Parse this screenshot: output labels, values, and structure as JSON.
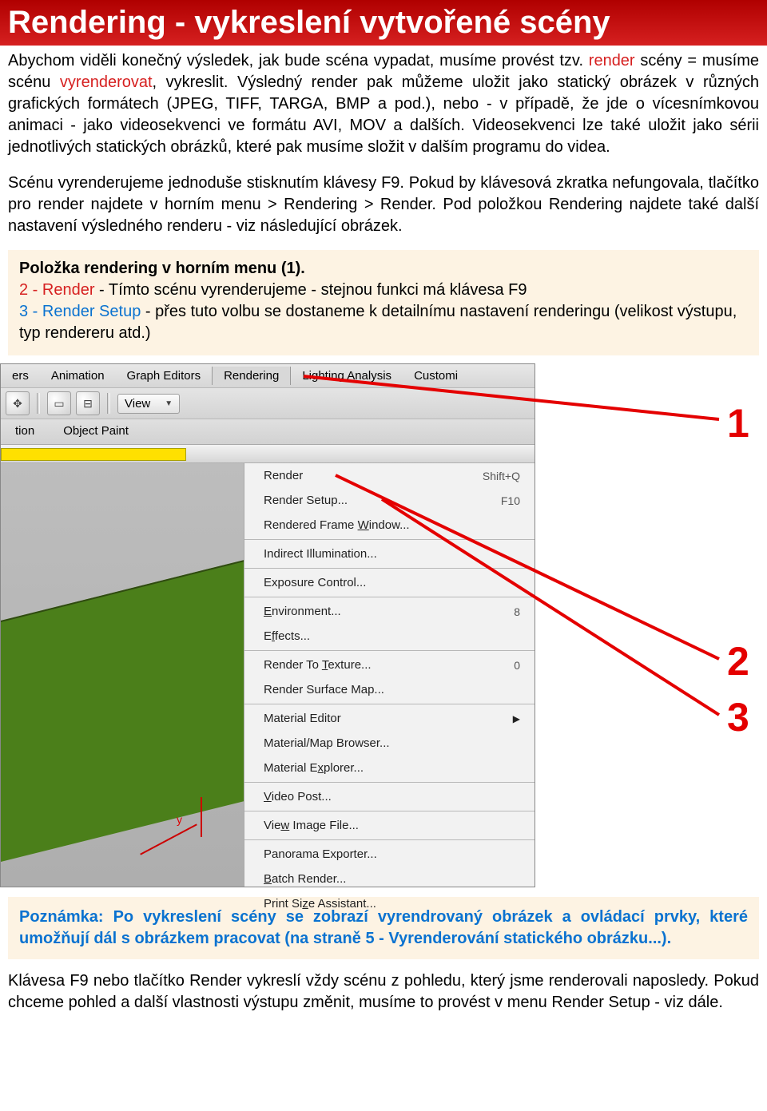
{
  "header": {
    "title": "Rendering - vykreslení vytvořené scény"
  },
  "intro": {
    "p1_a": "Abychom viděli konečný výsledek, jak bude scéna vypadat, musíme provést tzv. ",
    "p1_red1": "render",
    "p1_b": " scény = musíme scénu ",
    "p1_red2": "vyrenderovat",
    "p1_c": ", vykreslit. Výsledný render pak můžeme uložit jako statický obrázek v různých grafických formátech (JPEG, TIFF, TARGA, BMP a pod.), nebo - v případě, že jde o vícesnímkovou animaci - jako videosekvenci ve formátu AVI, MOV a dalších. Videosekvenci lze také uložit jako sérii jednotlivých statických obrázků, které pak musíme složit v dalším programu do videa.",
    "p2": "Scénu vyrenderujeme jednoduše stisknutím klávesy F9. Pokud by klávesová zkratka nefungovala, tlačítko pro render najdete v horním menu > Rendering > Render. Pod položkou Rendering najdete také další nastavení výsledného renderu - viz následující obrázek."
  },
  "callout": {
    "line1": "Položka rendering v horním menu (1).",
    "line2a": "2 - Render",
    "line2b": " - Tímto scénu vyrenderujeme - stejnou funkci má klávesa F9",
    "line3a": "3 - Render Setup",
    "line3b": " - přes tuto volbu se dostaneme k detailnímu nastavení renderingu (velikost výstupu, typ rendereru atd.)"
  },
  "menubar": {
    "items": [
      "ers",
      "Animation",
      "Graph Editors",
      "Rendering",
      "Lighting Analysis",
      "Customi"
    ]
  },
  "toolbar": {
    "view_label": "View"
  },
  "secondrow": {
    "items": [
      "tion",
      "Object Paint"
    ]
  },
  "dropdown": {
    "items": [
      {
        "label": "Render",
        "shortcut": "Shift+Q"
      },
      {
        "label": "Render Setup...",
        "shortcut": "F10"
      },
      {
        "label_pre": "Rendered Frame ",
        "underline": "W",
        "label_post": "indow..."
      },
      {
        "divider": true
      },
      {
        "label": "Indirect Illumination..."
      },
      {
        "divider": true
      },
      {
        "label": "Exposure Control..."
      },
      {
        "divider": true
      },
      {
        "label_pre": "",
        "underline": "E",
        "label_post": "nvironment...",
        "shortcut": "8"
      },
      {
        "label_pre": "E",
        "underline": "f",
        "label_post": "fects..."
      },
      {
        "divider": true
      },
      {
        "label_pre": "Render To ",
        "underline": "T",
        "label_post": "exture...",
        "shortcut": "0"
      },
      {
        "label": "Render Surface Map..."
      },
      {
        "divider": true
      },
      {
        "label": "Material Editor",
        "arrow": true
      },
      {
        "label": "Material/Map Browser..."
      },
      {
        "label_pre": "Material E",
        "underline": "x",
        "label_post": "plorer..."
      },
      {
        "divider": true
      },
      {
        "label_pre": "",
        "underline": "V",
        "label_post": "ideo Post..."
      },
      {
        "divider": true
      },
      {
        "label_pre": "Vie",
        "underline": "w",
        "label_post": " Image File..."
      },
      {
        "divider": true
      },
      {
        "label": "Panorama Exporter..."
      },
      {
        "label_pre": "",
        "underline": "B",
        "label_post": "atch Render..."
      },
      {
        "label_pre": "Print Si",
        "underline": "z",
        "label_post": "e Assistant..."
      }
    ]
  },
  "viewport": {
    "axis_y": "y"
  },
  "annotations": {
    "n1": "1",
    "n2": "2",
    "n3": "3"
  },
  "note": {
    "text": "Poznámka: Po vykreslení scény se zobrazí vyrendrovaný obrázek a ovládací prvky, které umožňují dál s obrázkem pracovat (na straně 5 - Vyrenderování statického obrázku...)."
  },
  "footer": {
    "text": "Klávesa F9 nebo tlačítko Render vykreslí vždy scénu z pohledu, který jsme renderovali naposledy. Pokud chceme pohled a další vlastnosti výstupu změnit, musíme to provést v menu Render Setup - viz dále."
  }
}
